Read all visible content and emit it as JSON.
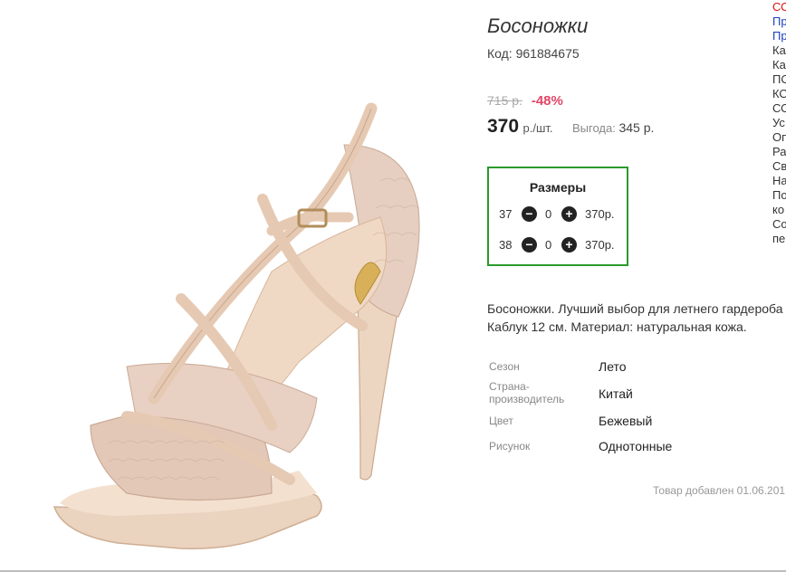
{
  "product": {
    "title": "Босоножки",
    "sku": "Код: 961884675",
    "old_price": "715 р.",
    "discount": "-48%",
    "price": "370",
    "price_unit": "р./шт.",
    "savings_label": "Выгода:",
    "savings_value": "345 р."
  },
  "sizes": {
    "title": "Размеры",
    "rows": [
      {
        "size": "37",
        "qty": "0",
        "price": "370р."
      },
      {
        "size": "38",
        "qty": "0",
        "price": "370р."
      }
    ]
  },
  "description": {
    "line1": "Босоножки. Лучший выбор для летнего гардероба",
    "line2": "Каблук 12 см. Материал: натуральная кожа."
  },
  "properties": [
    {
      "label": "Сезон",
      "value": "Лето"
    },
    {
      "label": "Страна-производитель",
      "value": "Китай"
    },
    {
      "label": "Цвет",
      "value": "Бежевый"
    },
    {
      "label": "Рисунок",
      "value": "Однотонные"
    }
  ],
  "added": "Товар добавлен 01.06.201",
  "right_menu": [
    "СО",
    "Пр",
    "Пр",
    "Ка",
    "Ка",
    "ПО",
    "КО",
    "СО",
    "Ус",
    "Оп",
    "Ра",
    "Св",
    "На",
    "По",
    "ко",
    "Со",
    "пе"
  ],
  "icons": {
    "minus": "minus-circle-icon",
    "plus": "plus-circle-icon"
  },
  "colors": {
    "accent_border": "#2b9a2b",
    "discount": "#e24567"
  }
}
